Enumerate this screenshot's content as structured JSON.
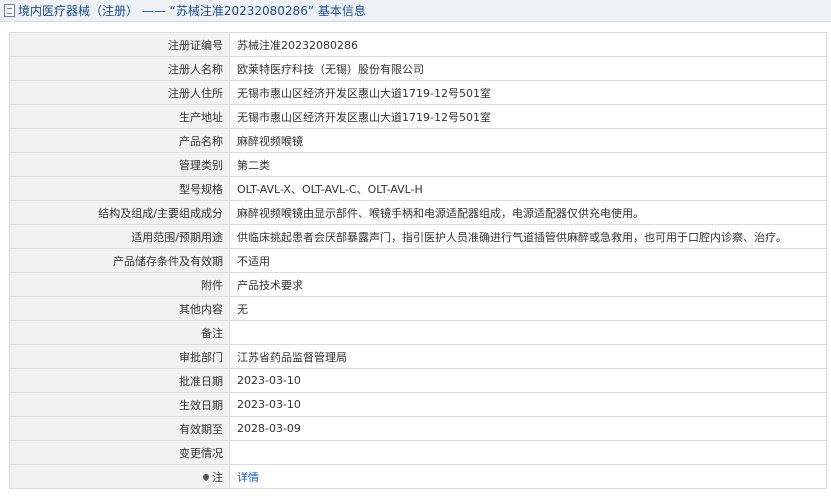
{
  "header": {
    "title": "境内医疗器械（注册） —— “苏械注准20232080286” 基本信息"
  },
  "rows": [
    {
      "label": "注册证编号",
      "value": "苏械注准20232080286"
    },
    {
      "label": "注册人名称",
      "value": "欧莱特医疗科技（无锡）股份有限公司"
    },
    {
      "label": "注册人住所",
      "value": "无锡市惠山区经济开发区惠山大道1719-12号501室"
    },
    {
      "label": "生产地址",
      "value": "无锡市惠山区经济开发区惠山大道1719-12号501室"
    },
    {
      "label": "产品名称",
      "value": "麻醉视频喉镜"
    },
    {
      "label": "管理类别",
      "value": "第二类"
    },
    {
      "label": "型号规格",
      "value": "OLT-AVL-X、OLT-AVL-C、OLT-AVL-H"
    },
    {
      "label": "结构及组成/主要组成成分",
      "value": "麻醉视频喉镜由显示部件、喉镜手柄和电源适配器组成，电源适配器仅供充电使用。"
    },
    {
      "label": "适用范围/预期用途",
      "value": "供临床挑起患者会厌部暴露声门，指引医护人员准确进行气道插管供麻醉或急救用，也可用于口腔内诊察、治疗。"
    },
    {
      "label": "产品储存条件及有效期",
      "value": "不适用"
    },
    {
      "label": "附件",
      "value": "产品技术要求"
    },
    {
      "label": "其他内容",
      "value": "无"
    },
    {
      "label": "备注",
      "value": ""
    },
    {
      "label": "审批部门",
      "value": "江苏省药品监督管理局"
    },
    {
      "label": "批准日期",
      "value": "2023-03-10"
    },
    {
      "label": "生效日期",
      "value": "2023-03-10"
    },
    {
      "label": "有效期至",
      "value": "2028-03-09"
    },
    {
      "label": "变更情况",
      "value": ""
    }
  ],
  "note_row": {
    "label": "注",
    "link": "详情"
  }
}
